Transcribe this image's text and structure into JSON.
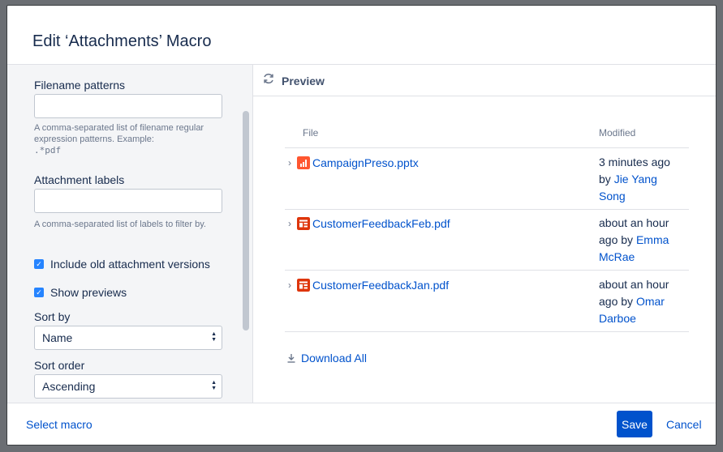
{
  "dialog": {
    "title": "Edit ‘Attachments’ Macro"
  },
  "form": {
    "filename_label": "Filename patterns",
    "filename_value": "",
    "filename_help": "A comma-separated list of filename regular expression patterns. Example:",
    "filename_example": ".*pdf",
    "labels_label": "Attachment labels",
    "labels_value": "",
    "labels_help": "A comma-separated list of labels to filter by.",
    "include_old_label": "Include old attachment versions",
    "include_old_checked": true,
    "show_previews_label": "Show previews",
    "show_previews_checked": true,
    "sort_by_label": "Sort by",
    "sort_by_value": "Name",
    "sort_order_label": "Sort order",
    "sort_order_value": "Ascending"
  },
  "preview": {
    "heading": "Preview",
    "col_file": "File",
    "col_modified": "Modified",
    "rows": [
      {
        "name": "CampaignPreso.pptx",
        "file_type": "pptx",
        "time_line1": "3 minutes ago",
        "time_line2": "by ",
        "author_a": "Jie Yang",
        "author_b": "Song"
      },
      {
        "name": "CustomerFeedbackFeb.pdf",
        "file_type": "pdf",
        "time_line1": "about an hour",
        "time_line2": "ago by ",
        "author_a": "Emma",
        "author_b": "McRae"
      },
      {
        "name": "CustomerFeedbackJan.pdf",
        "file_type": "pdf",
        "time_line1": "about an hour",
        "time_line2": "ago by ",
        "author_a": "Omar",
        "author_b": "Darboe"
      }
    ],
    "download_all": "Download All"
  },
  "footer": {
    "select_macro": "Select macro",
    "save": "Save",
    "cancel": "Cancel"
  },
  "colors": {
    "primary": "#0052cc",
    "checkbox": "#2684ff",
    "pptx_icon": "#ff5630",
    "pdf_icon": "#de350b"
  },
  "icons": {
    "refresh": "refresh-icon",
    "expand": "chevron-right-icon",
    "pptx": "presentation-file-icon",
    "pdf": "pdf-file-icon",
    "download": "download-icon",
    "select_arrows": "select-arrows-icon"
  }
}
